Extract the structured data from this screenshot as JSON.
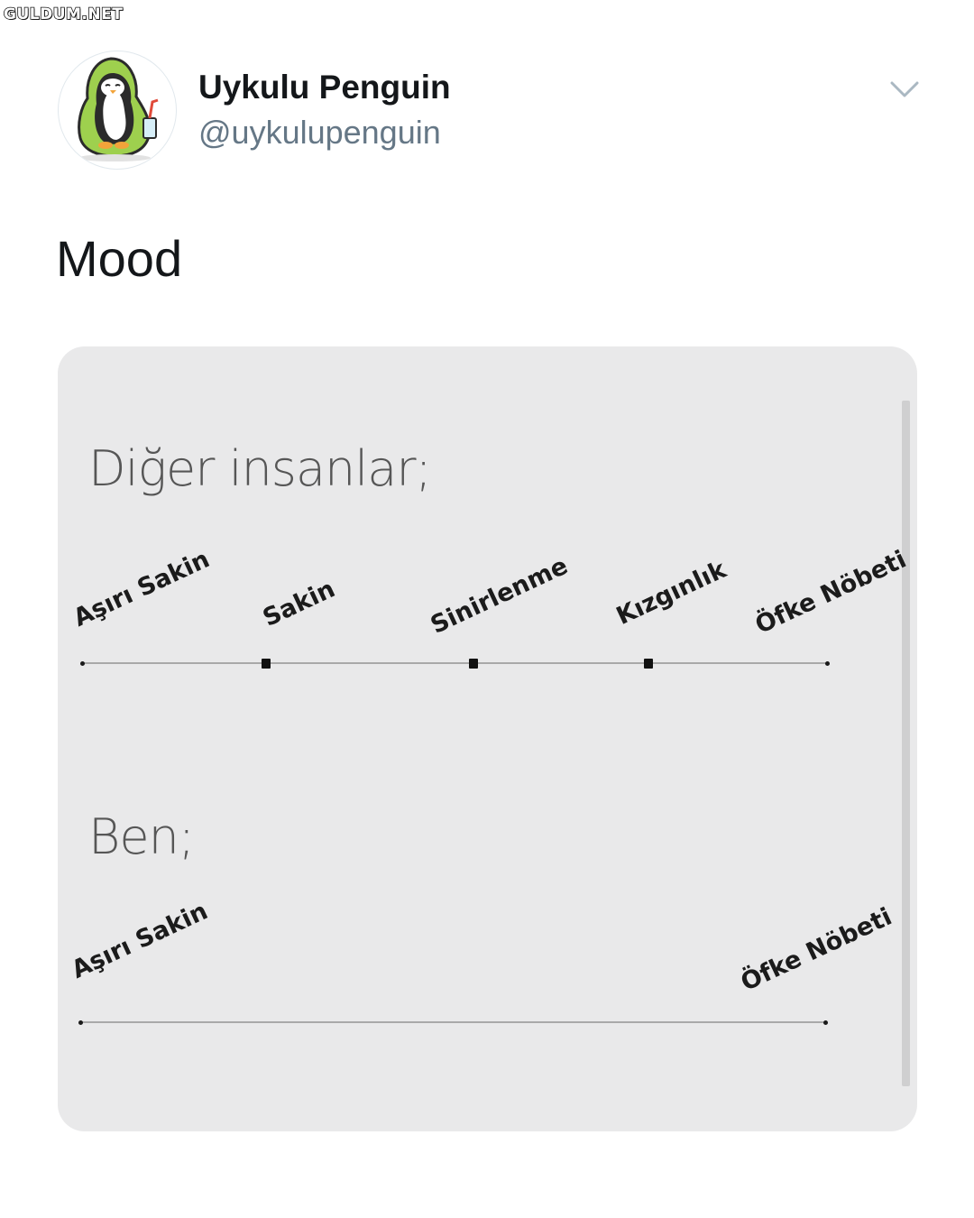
{
  "watermark": "GULDUM.NET",
  "tweet": {
    "display_name": "Uykulu Penguin",
    "handle": "@uykulupenguin",
    "text": "Mood",
    "menu_icon": "chevron-down-icon",
    "avatar_icon": "penguin-avatar-icon"
  },
  "media": {
    "sections": [
      {
        "title": "Diğer insanlar;",
        "labels": [
          "Aşırı Sakin",
          "Sakin",
          "Sinirlenme",
          "Kızgınlık",
          "Öfke Nöbeti"
        ]
      },
      {
        "title": "Ben;",
        "labels": [
          "Aşırı Sakin",
          "Öfke Nöbeti"
        ]
      }
    ]
  },
  "colors": {
    "name": "#14171a",
    "handle": "#657786",
    "card_bg": "#e9e9ea",
    "chevron": "#aab8c2"
  }
}
